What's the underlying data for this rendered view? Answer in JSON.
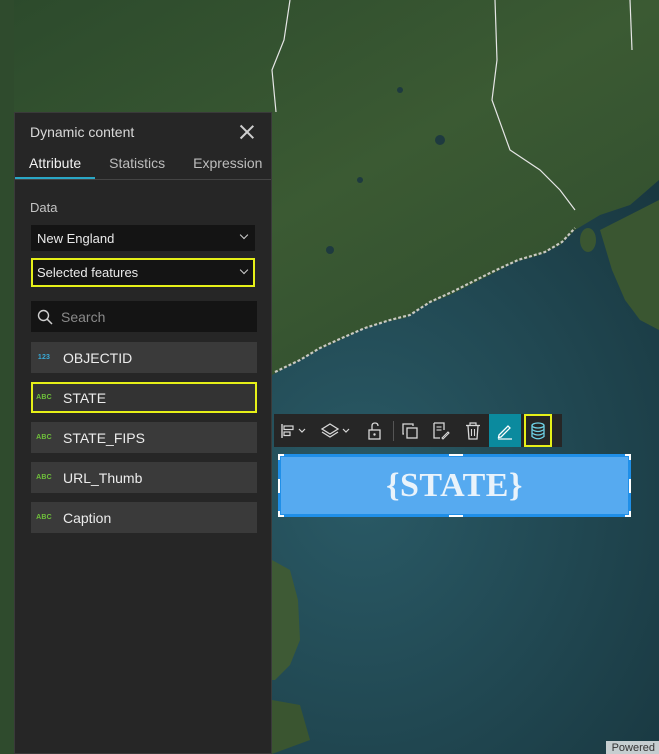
{
  "map": {
    "attribution": "Powered"
  },
  "panel": {
    "title": "Dynamic content",
    "tabs": [
      {
        "label": "Attribute",
        "active": true
      },
      {
        "label": "Statistics",
        "active": false
      },
      {
        "label": "Expression",
        "active": false
      }
    ],
    "data_label": "Data",
    "data_source": {
      "value": "New England"
    },
    "filter": {
      "value": "Selected features",
      "highlighted": true
    },
    "search": {
      "placeholder": "Search",
      "value": ""
    },
    "fields": [
      {
        "type_badge": "123",
        "type": "number",
        "name": "OBJECTID",
        "highlighted": false
      },
      {
        "type_badge": "ABC",
        "type": "string",
        "name": "STATE",
        "highlighted": true
      },
      {
        "type_badge": "ABC",
        "type": "string",
        "name": "STATE_FIPS",
        "highlighted": false
      },
      {
        "type_badge": "ABC",
        "type": "string",
        "name": "URL_Thumb",
        "highlighted": false
      },
      {
        "type_badge": "ABC",
        "type": "string",
        "name": "Caption",
        "highlighted": false
      }
    ]
  },
  "toolbar": {
    "buttons": [
      {
        "icon": "align-icon",
        "has_dropdown": true
      },
      {
        "icon": "layers-icon",
        "has_dropdown": true
      },
      {
        "icon": "unlock-icon"
      },
      {
        "icon": "duplicate-icon"
      },
      {
        "icon": "copy-style-icon"
      },
      {
        "icon": "delete-icon"
      },
      {
        "icon": "edit-icon",
        "active": true
      },
      {
        "icon": "database-icon",
        "highlighted": true
      }
    ]
  },
  "text_element": {
    "text": "{STATE}"
  },
  "colors": {
    "highlight": "#e6f018",
    "accent": "#0b8a9e",
    "selection": "#1f8fe8",
    "panel_bg": "#262626"
  }
}
